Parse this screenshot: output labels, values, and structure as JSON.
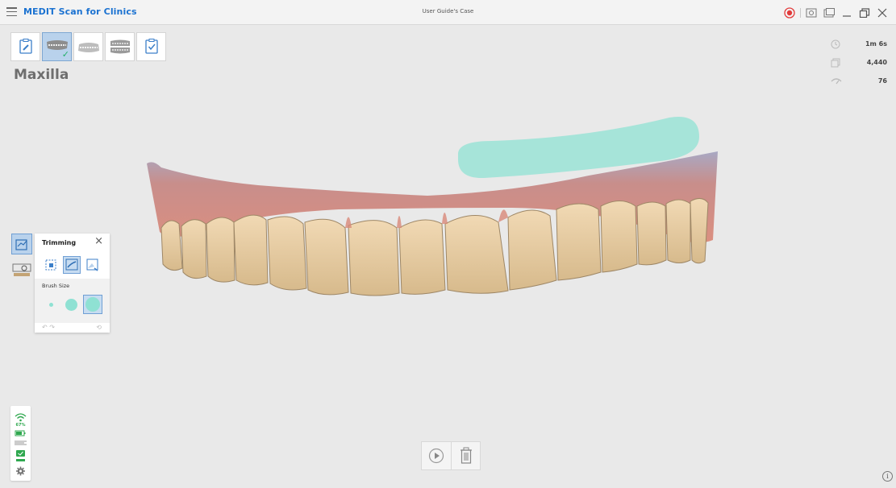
{
  "app": {
    "title": "MEDIT Scan for Clinics",
    "case_name": "User Guide's Case"
  },
  "titlebar": {
    "icons": [
      "record-icon",
      "screenshot-icon",
      "pip-window-icon",
      "minimize-icon",
      "restore-icon",
      "close-icon"
    ],
    "record_color": "#e23b3b"
  },
  "stages": [
    {
      "name": "edit-info",
      "icon": "pencil-form-icon",
      "active": false
    },
    {
      "name": "maxilla",
      "icon": "maxilla-icon",
      "active": true,
      "completed": true
    },
    {
      "name": "mandible",
      "icon": "mandible-icon",
      "active": false
    },
    {
      "name": "occlusion",
      "icon": "occlusion-icon",
      "active": false
    },
    {
      "name": "review",
      "icon": "checklist-icon",
      "active": false
    }
  ],
  "stage_title": "Maxilla",
  "stats": {
    "time": "1m 6s",
    "frames": "4,440",
    "rate": "76"
  },
  "trimming": {
    "title": "Trimming",
    "tools": [
      "lasso-select-icon",
      "brush-trim-icon",
      "connected-area-icon"
    ],
    "active_tool": 1,
    "brush_size_label": "Brush Size",
    "brush_sizes": [
      "small",
      "medium",
      "large"
    ],
    "selected_brush": 2
  },
  "status": {
    "wifi_percent": "67%",
    "accent": "#2fa84f"
  },
  "colors": {
    "accent": "#1b72d1",
    "active_bg": "#b9d2ec",
    "brush": "#8fe1d3"
  }
}
